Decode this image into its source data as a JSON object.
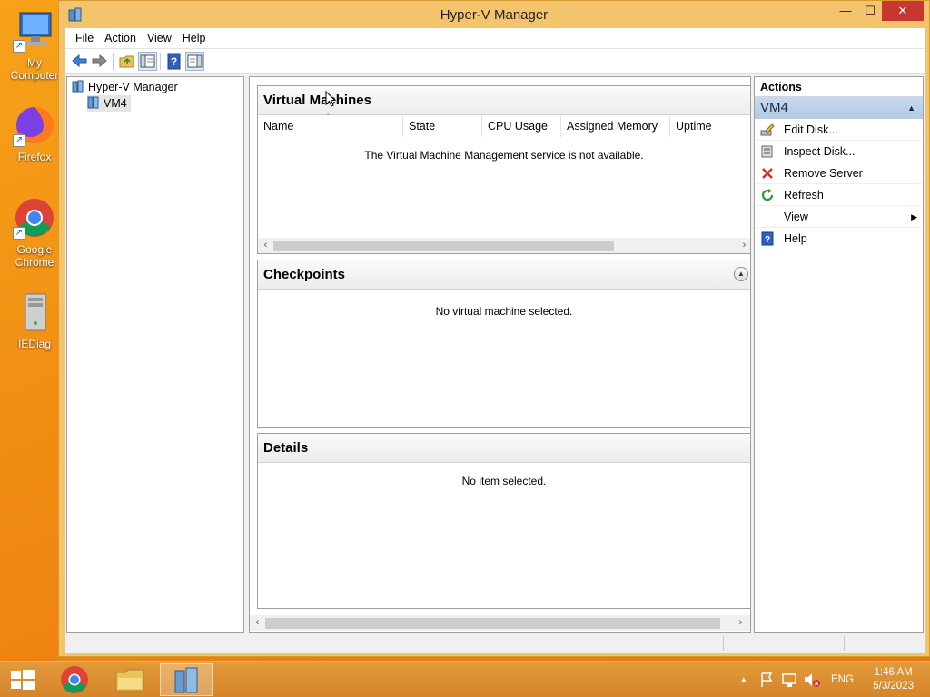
{
  "desktop": {
    "icons": [
      {
        "label": "My Computer",
        "icon": "computer-icon"
      },
      {
        "label": "Firefox",
        "icon": "firefox-icon"
      },
      {
        "label": "Google Chrome",
        "icon": "chrome-icon"
      },
      {
        "label": "IEDiag",
        "icon": "iediag-icon"
      }
    ]
  },
  "window": {
    "title": "Hyper-V Manager",
    "controls": {
      "minimize": "—",
      "maximize": "☐",
      "close": "✕"
    }
  },
  "menu": [
    "File",
    "Action",
    "View",
    "Help"
  ],
  "tree": {
    "root": "Hyper-V Manager",
    "child": "VM4"
  },
  "vm_pane": {
    "title": "Virtual Machines",
    "columns": [
      "Name",
      "State",
      "CPU Usage",
      "Assigned Memory",
      "Uptime"
    ],
    "message": "The Virtual Machine Management service is not available."
  },
  "checkpoints_pane": {
    "title": "Checkpoints",
    "message": "No virtual machine selected."
  },
  "details_pane": {
    "title": "Details",
    "message": "No item selected."
  },
  "actions": {
    "header": "Actions",
    "section": "VM4",
    "items": [
      {
        "label": "Edit Disk...",
        "icon": "edit-disk-icon"
      },
      {
        "label": "Inspect Disk...",
        "icon": "inspect-disk-icon"
      },
      {
        "label": "Remove Server",
        "icon": "remove-icon"
      },
      {
        "label": "Refresh",
        "icon": "refresh-icon"
      },
      {
        "label": "View",
        "icon": "none",
        "submenu": true
      },
      {
        "label": "Help",
        "icon": "help-icon"
      }
    ]
  },
  "taskbar": {
    "language": "ENG",
    "time": "1:46 AM",
    "date": "5/3/2023"
  },
  "colors": {
    "desktop": "#f08c12",
    "close_button": "#c7372f",
    "action_section": "#b9cfe8"
  }
}
